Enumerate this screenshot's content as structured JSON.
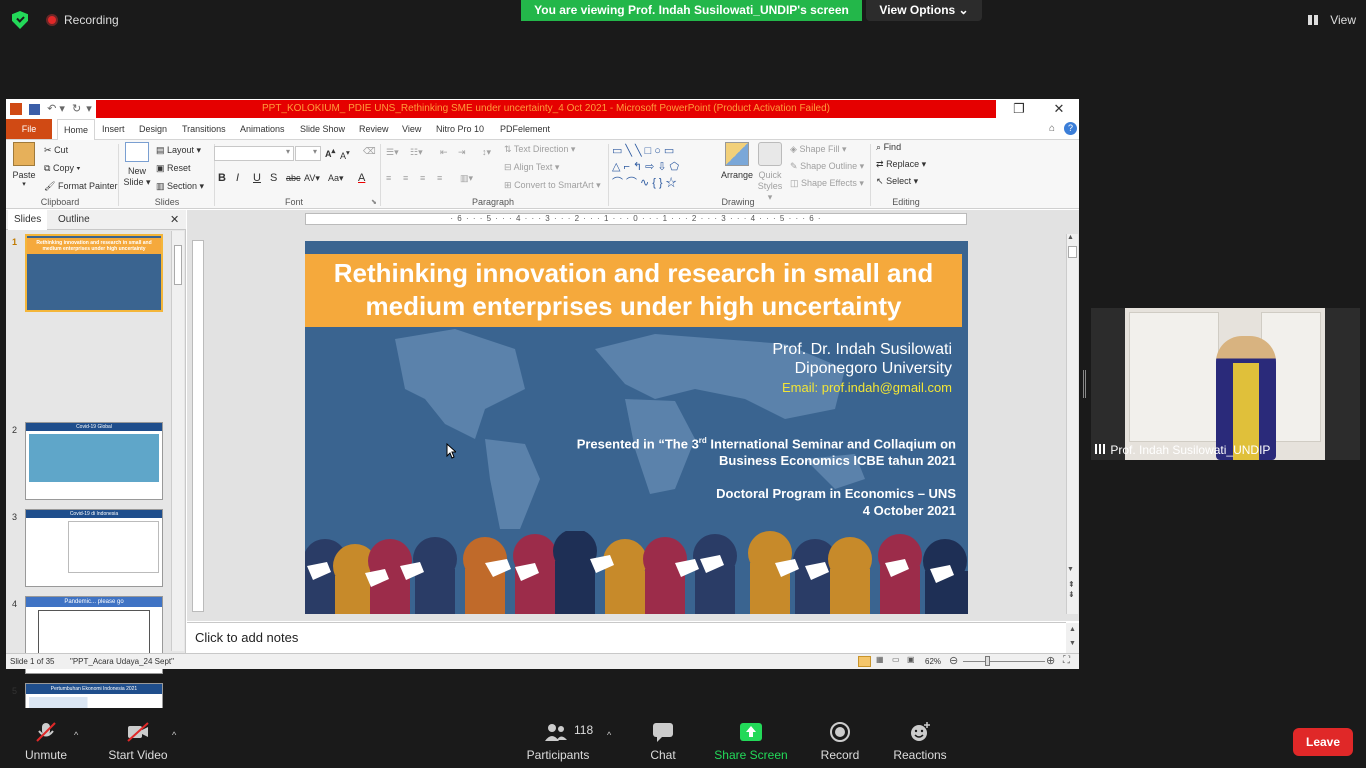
{
  "zoom": {
    "recording_label": "Recording",
    "viewing_banner": "You are viewing Prof. Indah Susilowati_UNDIP's screen",
    "view_options": "View Options ⌄",
    "view_label": "View",
    "participant_count": "118",
    "toolbar": {
      "unmute": "Unmute",
      "start_video": "Start Video",
      "participants": "Participants",
      "chat": "Chat",
      "share_screen": "Share Screen",
      "record": "Record",
      "reactions": "Reactions",
      "leave": "Leave"
    },
    "video_name": "Prof. Indah Susilowati_UNDIP",
    "colors": {
      "banner": "#23b74a",
      "leave": "#e02828",
      "share": "#23d959"
    }
  },
  "ppt": {
    "title": "PPT_KOLOKIUM_ PDIE UNS_Rethinking SME under uncertainty_4 Oct 2021  -  Microsoft PowerPoint (Product Activation Failed)",
    "tabs": [
      "File",
      "Home",
      "Insert",
      "Design",
      "Transitions",
      "Animations",
      "Slide Show",
      "Review",
      "View",
      "Nitro Pro 10",
      "PDFelement"
    ],
    "clipboard": {
      "paste": "Paste",
      "cut": "Cut",
      "copy": "Copy ▾",
      "format_painter": "Format Painter",
      "label": "Clipboard"
    },
    "slides_group": {
      "new_slide": "New Slide ▾",
      "layout": "Layout ▾",
      "reset": "Reset",
      "section": "Section ▾",
      "label": "Slides"
    },
    "font_group": {
      "label": "Font"
    },
    "paragraph": {
      "text_direction": "Text Direction ▾",
      "align_text": "Align Text ▾",
      "convert": "Convert to SmartArt ▾",
      "label": "Paragraph"
    },
    "drawing": {
      "arrange": "Arrange",
      "quick_styles": "Quick Styles ▾",
      "shape_fill": "Shape Fill ▾",
      "shape_outline": "Shape Outline ▾",
      "shape_effects": "Shape Effects ▾",
      "label": "Drawing"
    },
    "editing": {
      "find": "Find",
      "replace": "Replace ▾",
      "select": "Select ▾",
      "label": "Editing"
    },
    "pane_tabs": {
      "slides": "Slides",
      "outline": "Outline"
    },
    "thumbnails": [
      {
        "num": "1",
        "title": "Rethinking innovation and research  in small and medium enterprises under high uncertainty"
      },
      {
        "num": "2",
        "title": "Covid-19 Global"
      },
      {
        "num": "3",
        "title": "Covid-19 di Indonesia"
      },
      {
        "num": "4",
        "title": "Pandemic... please go"
      },
      {
        "num": "5",
        "title": "Pertumbuhan Ekonomi Indonesia 2021"
      }
    ],
    "ruler": "· 6 · · · 5 · · · 4 · · · 3 · · · 2 · · · 1 · · · 0 · · · 1 · · · 2 · · · 3 · · · 4 · · · 5 · · · 6 ·",
    "notes_placeholder": "Click to add notes",
    "status": {
      "slide": "Slide 1 of 35",
      "theme": "\"PPT_Acara Udaya_24 Sept\"",
      "zoom": "62%"
    }
  },
  "slide": {
    "title": "Rethinking innovation and research  in small and medium enterprises under high uncertainty",
    "author": "Prof. Dr. Indah Susilowati",
    "university": "Diponegoro University",
    "email": "Email: prof.indah@gmail.com",
    "presented_prefix": "Presented in “The 3",
    "presented_sup": "rd",
    "presented_suffix": " International  Seminar and Collaqium on",
    "presented_line2": "Business Economics ICBE tahun 2021",
    "program": "Doctoral Program in Economics – UNS",
    "date": "4 October 2021",
    "colors": {
      "background": "#3a6490",
      "title_box": "#f5a93c",
      "email": "#f2e536"
    }
  }
}
